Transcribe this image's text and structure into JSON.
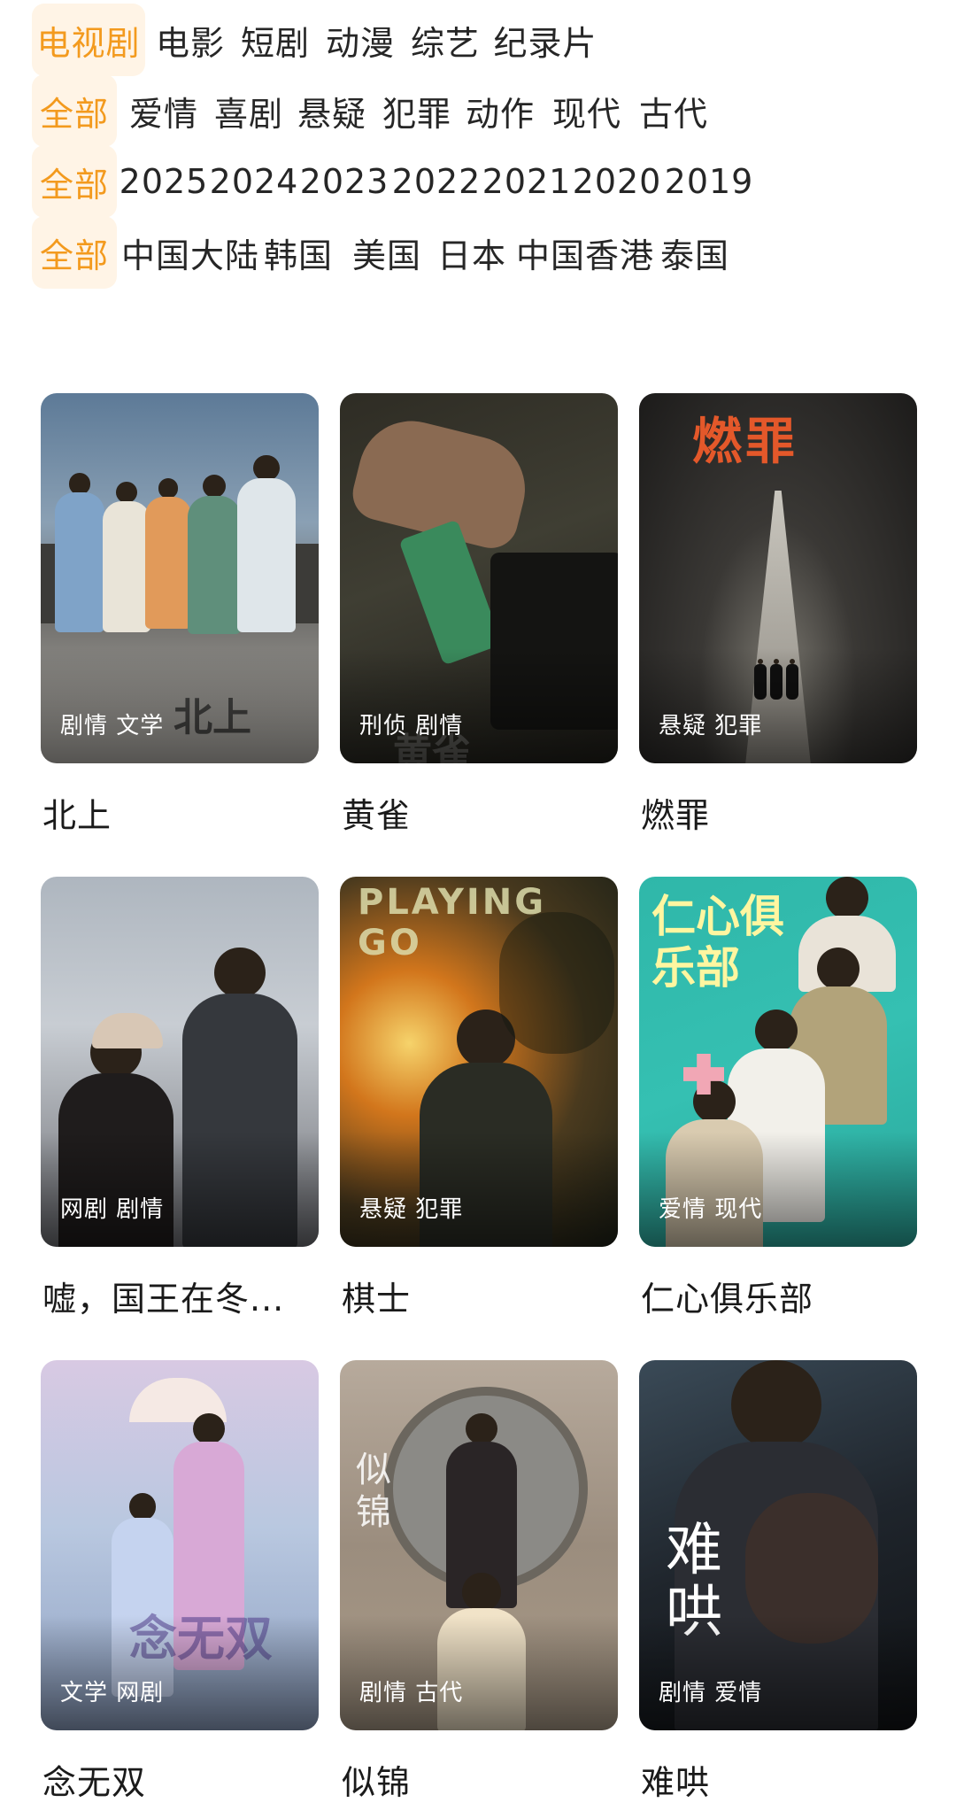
{
  "filters": {
    "rows": [
      {
        "chips": [
          {
            "label": "电视剧",
            "active": true
          },
          {
            "label": "电影",
            "active": false
          },
          {
            "label": "短剧",
            "active": false
          },
          {
            "label": "动漫",
            "active": false
          },
          {
            "label": "综艺",
            "active": false
          },
          {
            "label": "纪录片",
            "active": false
          }
        ]
      },
      {
        "chips": [
          {
            "label": "全部",
            "active": true
          },
          {
            "label": "爱情",
            "active": false
          },
          {
            "label": "喜剧",
            "active": false
          },
          {
            "label": "悬疑",
            "active": false
          },
          {
            "label": "犯罪",
            "active": false
          },
          {
            "label": "动作",
            "active": false
          },
          {
            "label": "现代",
            "active": false
          },
          {
            "label": "古代",
            "active": false
          }
        ]
      },
      {
        "chips": [
          {
            "label": "全部",
            "active": true
          },
          {
            "label": "2025",
            "active": false
          },
          {
            "label": "2024",
            "active": false
          },
          {
            "label": "2023",
            "active": false
          },
          {
            "label": "2022",
            "active": false
          },
          {
            "label": "2021",
            "active": false
          },
          {
            "label": "2020",
            "active": false
          },
          {
            "label": "2019",
            "active": false
          }
        ]
      },
      {
        "chips": [
          {
            "label": "全部",
            "active": true
          },
          {
            "label": "中国大陆",
            "active": false
          },
          {
            "label": "韩国",
            "active": false
          },
          {
            "label": "美国",
            "active": false
          },
          {
            "label": "日本",
            "active": false
          },
          {
            "label": "中国香港",
            "active": false
          },
          {
            "label": "泰国",
            "active": false
          }
        ]
      }
    ]
  },
  "shows": [
    {
      "title": "北上",
      "tags": "剧情 文学",
      "poster_text": "北上"
    },
    {
      "title": "黄雀",
      "tags": "刑侦 剧情",
      "poster_text": "黄雀"
    },
    {
      "title": "燃罪",
      "tags": "悬疑 犯罪",
      "poster_text": "燃罪"
    },
    {
      "title": "嘘，国王在冬...",
      "tags": "网剧 剧情",
      "poster_text": ""
    },
    {
      "title": "棋士",
      "tags": "悬疑 犯罪",
      "poster_text": "PLAYING GO"
    },
    {
      "title": "仁心俱乐部",
      "tags": "爱情 现代",
      "poster_text": "仁心俱乐部"
    },
    {
      "title": "念无双",
      "tags": "文学 网剧",
      "poster_text": "念无双"
    },
    {
      "title": "似锦",
      "tags": "剧情 古代",
      "poster_text": "似锦"
    },
    {
      "title": "难哄",
      "tags": "剧情 爱情",
      "poster_text": "难哄"
    }
  ],
  "colors": {
    "accent": "#f39a1e",
    "accent_bg": "#fff4e6"
  }
}
